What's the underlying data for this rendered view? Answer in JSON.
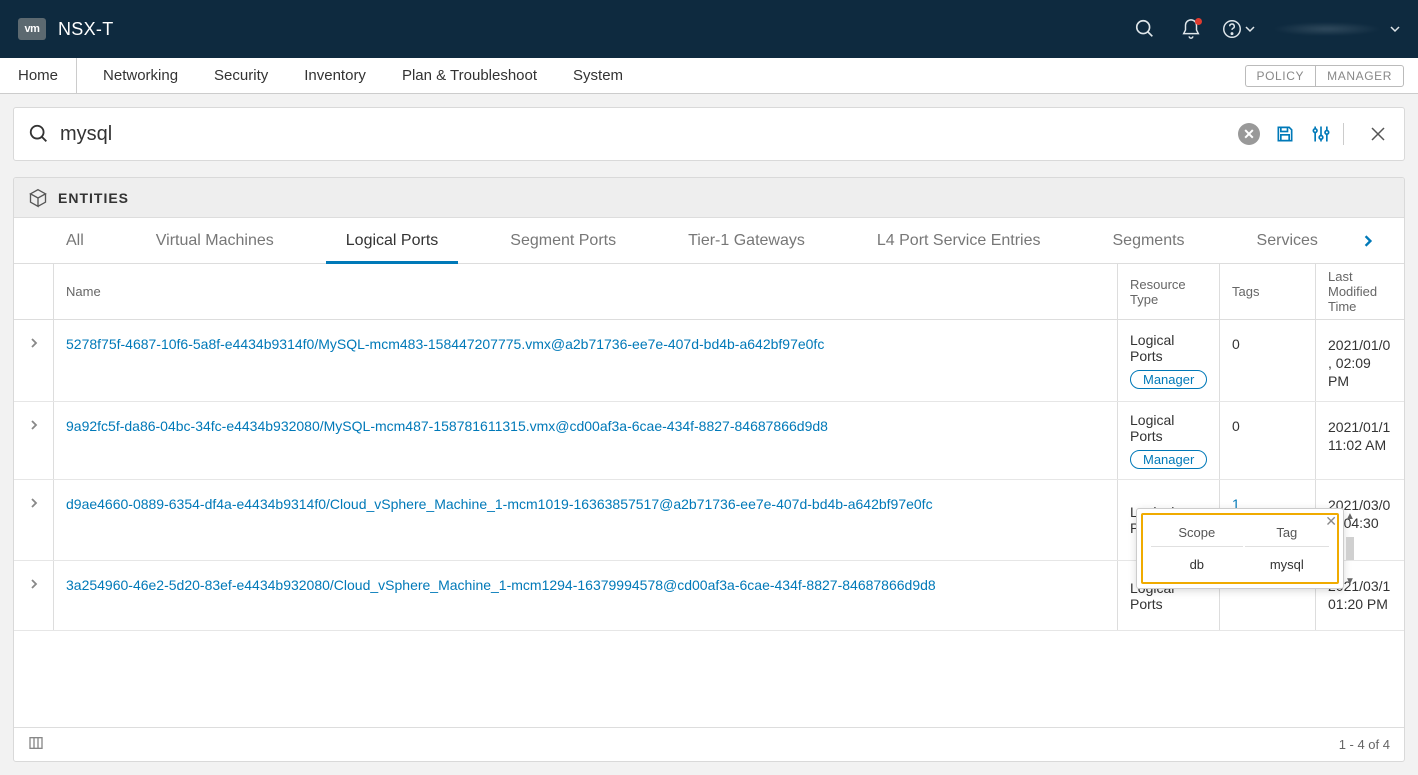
{
  "brand": {
    "logo_text": "vm",
    "name": "NSX-T"
  },
  "nav": {
    "items": [
      "Home",
      "Networking",
      "Security",
      "Inventory",
      "Plan & Troubleshoot",
      "System"
    ],
    "mode_policy": "POLICY",
    "mode_manager": "MANAGER"
  },
  "search": {
    "value": "mysql"
  },
  "section": {
    "title": "ENTITIES"
  },
  "filter_tabs": [
    "All",
    "Virtual Machines",
    "Logical Ports",
    "Segment Ports",
    "Tier-1 Gateways",
    "L4 Port Service Entries",
    "Segments",
    "Services"
  ],
  "active_filter_index": 2,
  "columns": {
    "name": "Name",
    "type": "Resource Type",
    "tags": "Tags",
    "time": "Last Modified Time"
  },
  "rows": [
    {
      "name": "5278f75f-4687-10f6-5a8f-e4434b9314f0/MySQL-mcm483-158447207775.vmx@a2b71736-ee7e-407d-bd4b-a642bf97e0fc",
      "type": "Logical Ports",
      "pill": "Manager",
      "tags": "0",
      "tags_link": false,
      "time": "2021/01/0 , 02:09 PM"
    },
    {
      "name": "9a92fc5f-da86-04bc-34fc-e4434b932080/MySQL-mcm487-158781611315.vmx@cd00af3a-6cae-434f-8827-84687866d9d8",
      "type": "Logical Ports",
      "pill": "Manager",
      "tags": "0",
      "tags_link": false,
      "time": "2021/01/1 11:02 AM"
    },
    {
      "name": "d9ae4660-0889-6354-df4a-e4434b9314f0/Cloud_vSphere_Machine_1-mcm1019-16363857517@a2b71736-ee7e-407d-bd4b-a642bf97e0fc",
      "type": "Logical Ports",
      "pill": "",
      "tags": "1",
      "tags_link": true,
      "time": "2021/03/0 8, 04:30 M"
    },
    {
      "name": "3a254960-46e2-5d20-83ef-e4434b932080/Cloud_vSphere_Machine_1-mcm1294-16379994578@cd00af3a-6cae-434f-8827-84687866d9d8",
      "type": "Logical Ports",
      "pill": "",
      "tags": "",
      "tags_link": false,
      "time": "2021/03/1 01:20 PM"
    }
  ],
  "footer": {
    "range": "1 - 4 of 4"
  },
  "tag_popover": {
    "col_scope": "Scope",
    "col_tag": "Tag",
    "scope_val": "db",
    "tag_val": "mysql"
  }
}
